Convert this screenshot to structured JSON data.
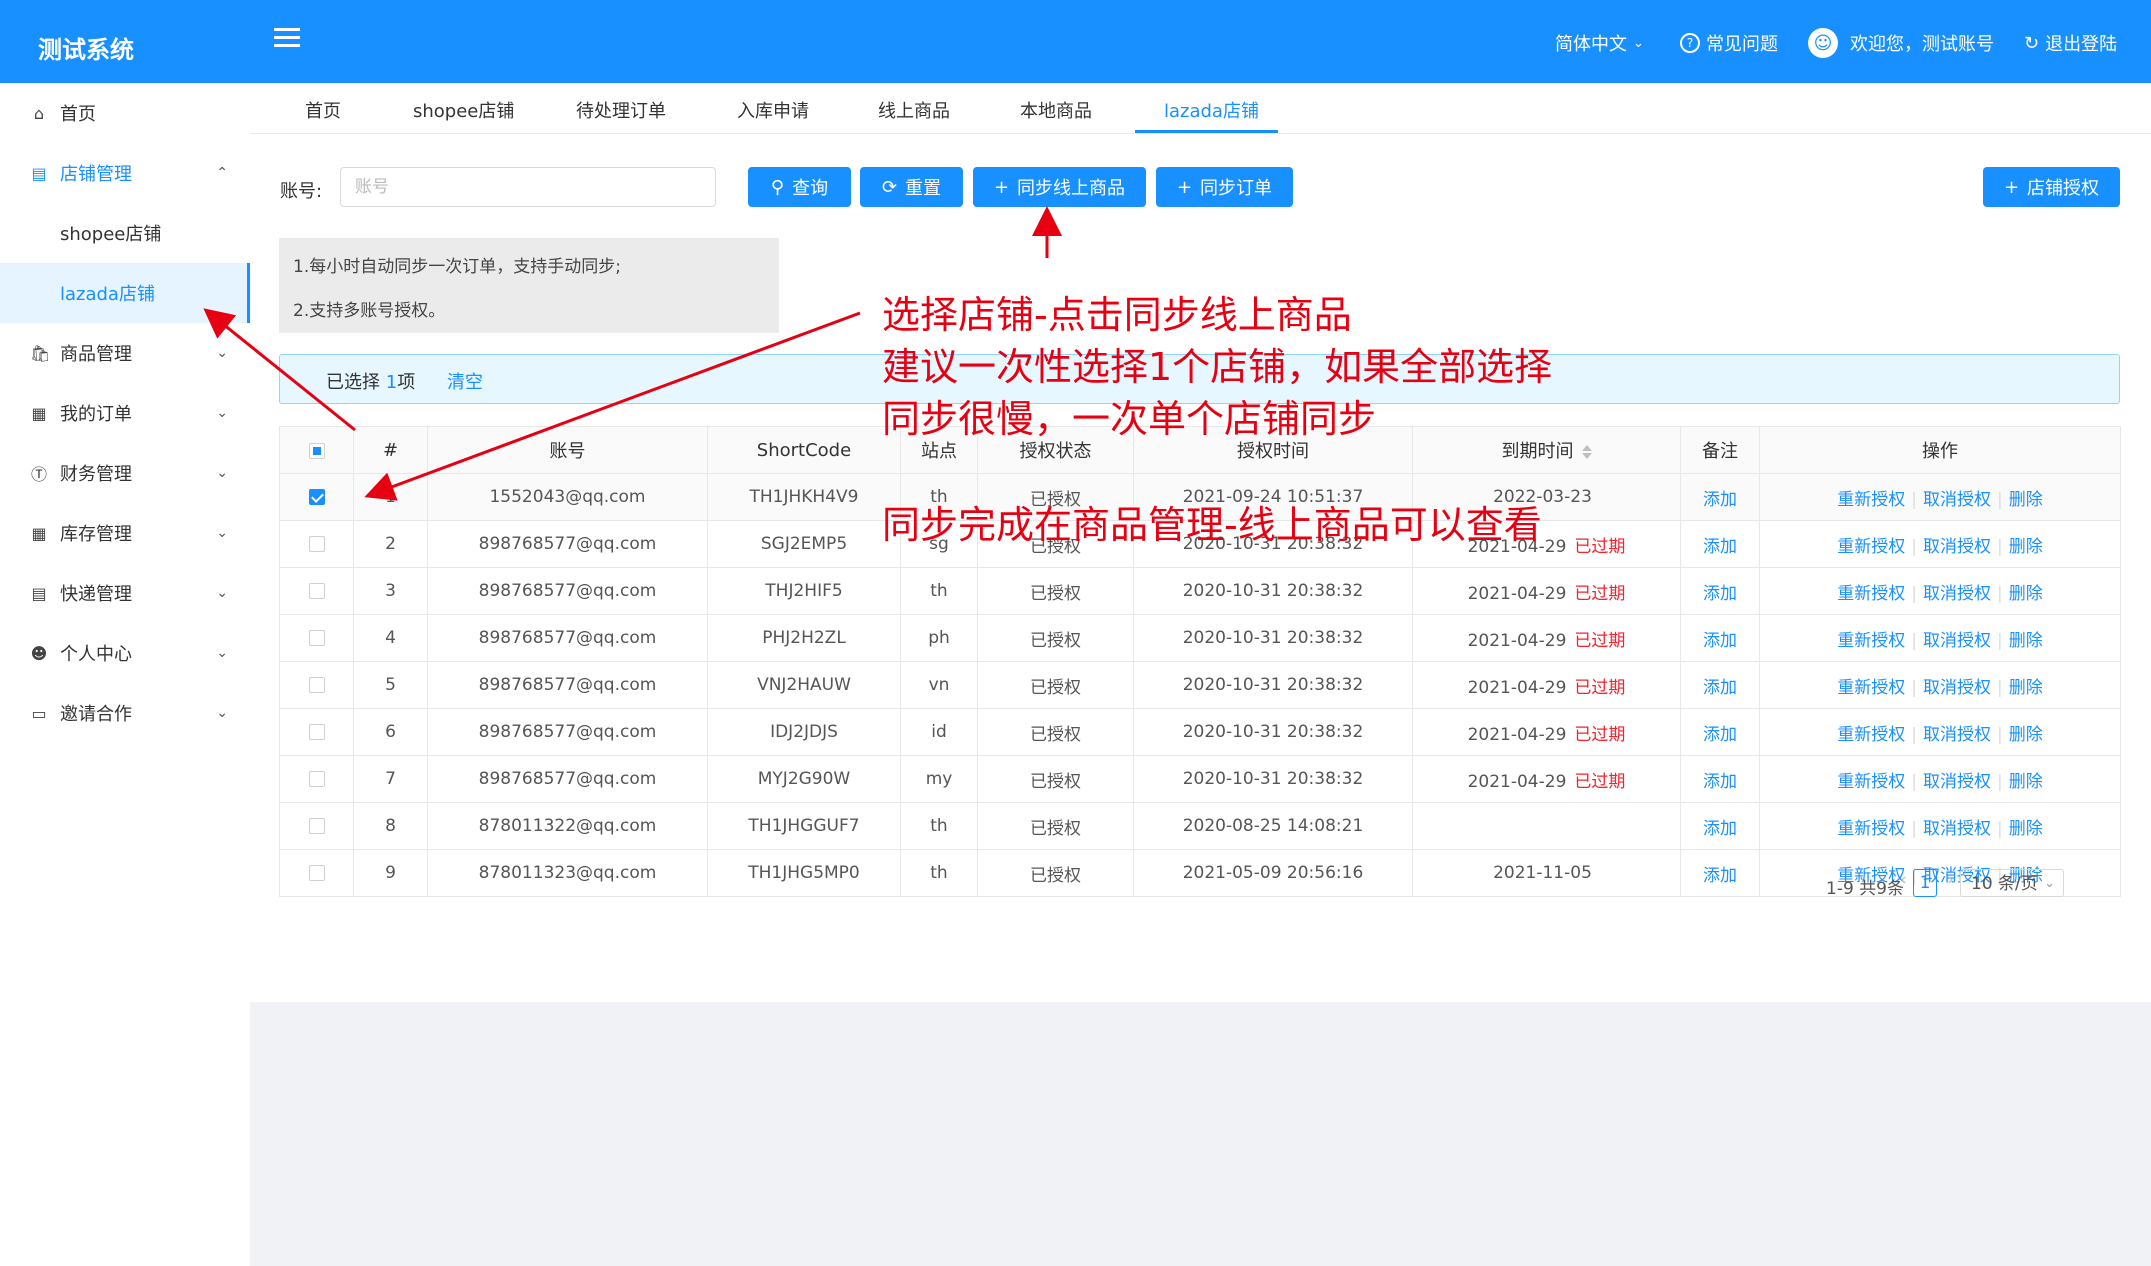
{
  "header": {
    "logo": "测试系统",
    "language": "简体中文",
    "faq": "常见问题",
    "welcome": "欢迎您，测试账号",
    "logout": "退出登陆",
    "brand_color": "#1890ff"
  },
  "sidebar": {
    "items": [
      {
        "label": "首页",
        "icon": "home-icon"
      },
      {
        "label": "店铺管理",
        "icon": "store-icon",
        "expanded": true,
        "children": [
          {
            "label": "shopee店铺"
          },
          {
            "label": "lazada店铺",
            "active": true
          }
        ]
      },
      {
        "label": "商品管理",
        "icon": "bag-icon"
      },
      {
        "label": "我的订单",
        "icon": "order-icon"
      },
      {
        "label": "财务管理",
        "icon": "finance-icon"
      },
      {
        "label": "库存管理",
        "icon": "grid-icon"
      },
      {
        "label": "快递管理",
        "icon": "express-icon"
      },
      {
        "label": "个人中心",
        "icon": "user-icon"
      },
      {
        "label": "邀请合作",
        "icon": "laptop-icon"
      }
    ]
  },
  "tabs": [
    {
      "label": "首页"
    },
    {
      "label": "shopee店铺"
    },
    {
      "label": "待处理订单"
    },
    {
      "label": "入库申请"
    },
    {
      "label": "线上商品"
    },
    {
      "label": "本地商品"
    },
    {
      "label": "lazada店铺",
      "active": true
    }
  ],
  "search": {
    "label": "账号:",
    "placeholder": "账号",
    "value": ""
  },
  "toolbar": {
    "query": "查询",
    "reset": "重置",
    "sync_products": "同步线上商品",
    "sync_orders": "同步订单",
    "authorize": "店铺授权"
  },
  "tips": [
    "1.每小时自动同步一次订单，支持手动同步;",
    "2.支持多账号授权。"
  ],
  "selection": {
    "prefix": "已选择",
    "count": "1",
    "suffix": "项",
    "clear": "清空"
  },
  "table": {
    "headers": [
      "#",
      "账号",
      "ShortCode",
      "站点",
      "授权状态",
      "授权时间",
      "到期时间",
      "备注",
      "操作"
    ],
    "rows": [
      {
        "no": "1",
        "account": "1552043@qq.com",
        "shortcode": "TH1JHKH4V9",
        "site": "th",
        "status": "已授权",
        "auth_time": "2021-09-24 10:51:37",
        "expire": "2022-03-23",
        "expired": "",
        "checked": true
      },
      {
        "no": "2",
        "account": "898768577@qq.com",
        "shortcode": "SGJ2EMP5",
        "site": "sg",
        "status": "已授权",
        "auth_time": "2020-10-31 20:38:32",
        "expire": "2021-04-29",
        "expired": "已过期",
        "checked": false
      },
      {
        "no": "3",
        "account": "898768577@qq.com",
        "shortcode": "THJ2HIF5",
        "site": "th",
        "status": "已授权",
        "auth_time": "2020-10-31 20:38:32",
        "expire": "2021-04-29",
        "expired": "已过期",
        "checked": false
      },
      {
        "no": "4",
        "account": "898768577@qq.com",
        "shortcode": "PHJ2H2ZL",
        "site": "ph",
        "status": "已授权",
        "auth_time": "2020-10-31 20:38:32",
        "expire": "2021-04-29",
        "expired": "已过期",
        "checked": false
      },
      {
        "no": "5",
        "account": "898768577@qq.com",
        "shortcode": "VNJ2HAUW",
        "site": "vn",
        "status": "已授权",
        "auth_time": "2020-10-31 20:38:32",
        "expire": "2021-04-29",
        "expired": "已过期",
        "checked": false
      },
      {
        "no": "6",
        "account": "898768577@qq.com",
        "shortcode": "IDJ2JDJS",
        "site": "id",
        "status": "已授权",
        "auth_time": "2020-10-31 20:38:32",
        "expire": "2021-04-29",
        "expired": "已过期",
        "checked": false
      },
      {
        "no": "7",
        "account": "898768577@qq.com",
        "shortcode": "MYJ2G90W",
        "site": "my",
        "status": "已授权",
        "auth_time": "2020-10-31 20:38:32",
        "expire": "2021-04-29",
        "expired": "已过期",
        "checked": false
      },
      {
        "no": "8",
        "account": "878011322@qq.com",
        "shortcode": "TH1JHGGUF7",
        "site": "th",
        "status": "已授权",
        "auth_time": "2020-08-25 14:08:21",
        "expire": "",
        "expired": "",
        "checked": false
      },
      {
        "no": "9",
        "account": "878011323@qq.com",
        "shortcode": "TH1JHG5MP0",
        "site": "th",
        "status": "已授权",
        "auth_time": "2021-05-09 20:56:16",
        "expire": "2021-11-05",
        "expired": "",
        "checked": false
      }
    ],
    "remark_action": "添加",
    "actions": [
      "重新授权",
      "取消授权",
      "删除"
    ]
  },
  "pagination": {
    "total_text": "1-9 共9条",
    "current_page": "1",
    "page_size": "10 条/页"
  },
  "annotations": {
    "line1": "选择店铺-点击同步线上商品",
    "line2": "建议一次性选择1个店铺，如果全部选择",
    "line3": "同步很慢，一次单个店铺同步",
    "line4": "同步完成在商品管理-线上商品可以查看",
    "color": "#e60012"
  }
}
